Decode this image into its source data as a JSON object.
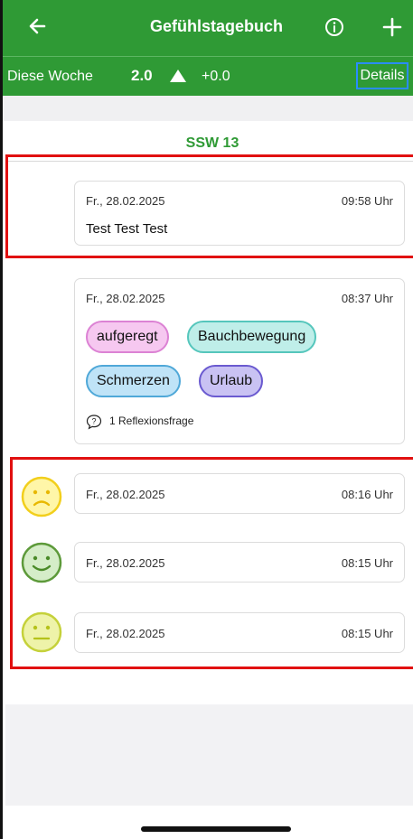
{
  "header": {
    "title": "Gefühlstagebuch",
    "back_icon": "arrow-left-icon",
    "info_icon": "info-circle-icon",
    "add_icon": "plus-icon"
  },
  "week": {
    "label": "Diese Woche",
    "score": "2.0",
    "trend_icon": "triangle-up-icon",
    "delta": "+0.0",
    "details_label": "Details"
  },
  "section": {
    "title": "SSW 13"
  },
  "entries": [
    {
      "date": "Fr., 28.02.2025",
      "time": "09:58 Uhr",
      "text": "Test Test Test"
    },
    {
      "date": "Fr., 28.02.2025",
      "time": "08:37 Uhr",
      "tags": [
        "aufgeregt",
        "Bauchbewegung",
        "Schmerzen",
        "Urlaub"
      ],
      "reflection": "1 Reflexionsfrage",
      "reflection_icon": "question-bubble-icon"
    },
    {
      "date": "Fr., 28.02.2025",
      "time": "08:16 Uhr",
      "mood_icon": "sad-face-icon"
    },
    {
      "date": "Fr., 28.02.2025",
      "time": "08:15 Uhr",
      "mood_icon": "happy-face-icon"
    },
    {
      "date": "Fr., 28.02.2025",
      "time": "08:15 Uhr",
      "mood_icon": "neutral-face-icon"
    }
  ],
  "colors": {
    "brand_green": "#2f9a35",
    "highlight_red": "#e11010",
    "focus_blue": "#2a8cff",
    "tag_aufgeregt": "#f6c8f0",
    "tag_bauchbewegung": "#bfeee9",
    "tag_schmerzen": "#bfe3f7",
    "tag_urlaub": "#c9c2f3"
  }
}
